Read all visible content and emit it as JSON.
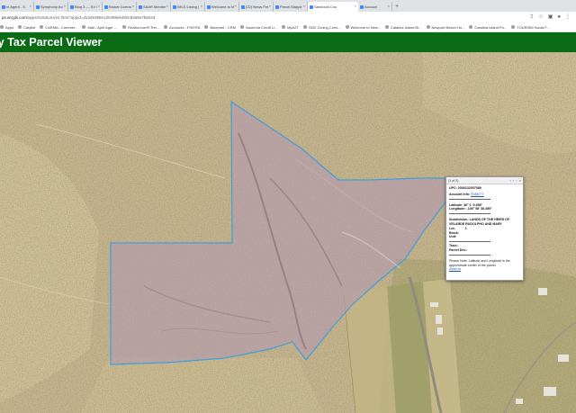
{
  "browser": {
    "tabs": [
      {
        "label": "nt Agent - S"
      },
      {
        "label": "Symphony Account"
      },
      {
        "label": "Blog 3 — SV Consult"
      },
      {
        "label": "Broker License Appl"
      },
      {
        "label": "SAAR Member Portal"
      },
      {
        "label": "IMLS Listing | Naviga"
      },
      {
        "label": "Welcome to Molisan"
      },
      {
        "label": "(22) News Feed — Fac"
      },
      {
        "label": "Parcel Mapping - SV"
      },
      {
        "label": "Sandoval County Tax",
        "active": true
      },
      {
        "label": "Account"
      }
    ],
    "new_tab": "+",
    "url_host": "ps.arcgis.com",
    "url_path": "/apps/Solutions/s2.html?appid=d13de385e130498eb4b0c83a9e7b6e2d",
    "bookmarks": [
      "Apps",
      "Catylist",
      "CARMA - Commer...",
      "Mail - April Ager -...",
      "Realtor.com® Rel...",
      "Accounts - FINTRA",
      "Blueprint - CRM",
      "Nusenda Credit U...",
      "MyAZT",
      "SDD Zoning Cons...",
      "Welcome to New...",
      "Catalina Island Br...",
      "Newport Beach Ho...",
      "Catalina Island Pu...",
      "TOURISM Santa F..."
    ]
  },
  "app": {
    "title": "nty Tax Parcel Viewer"
  },
  "popup": {
    "pager": "(1 of 2)",
    "upc_label": "UPC:",
    "upc_value": "2006132007089",
    "account_label": "Account Info:",
    "account_value": "R056777",
    "latitude_label": "Latitude:",
    "latitude_value": "36° 1' 9.458\"",
    "longitude_label": "Longitude:",
    "longitude_value": "-106° 58' 38.455\"",
    "subdivision_label": "Subdivision:",
    "subdivision_value": "LANDS OF THE HEIRS OF VELARDE RUDOLPHO AND MARY",
    "lot_label": "Lot:",
    "lot_value": "1",
    "block_label": "Block:",
    "unit_label": "Unit:",
    "tract_label": "Tract:",
    "parcel_dev_label": "Parcel Dev.:",
    "note": "Please Note: Latitude and Longitude is the approximate center of the parcel.",
    "zoom_link": "Zoom to"
  },
  "colors": {
    "header_green": "#0b6a14",
    "parcel_fill": "#b39ab0",
    "parcel_outline": "#3fa0d8"
  }
}
